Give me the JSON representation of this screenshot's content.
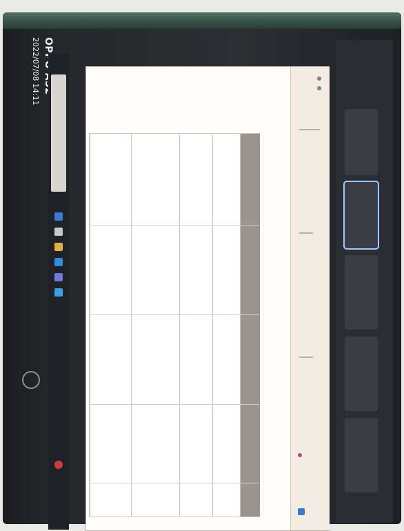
{
  "watermark": {
    "model": "OPPO A52",
    "datetime": "2022/07/08 14:11"
  },
  "colors": {
    "monitor": "#25272b",
    "page": "#fffdf9",
    "table_header": "#9b948d",
    "accent": "#9cc9ff"
  },
  "meeting": {
    "participants": [
      {
        "label": "",
        "active": false
      },
      {
        "label": "",
        "active": true
      },
      {
        "label": "",
        "active": false
      },
      {
        "label": "",
        "active": false
      },
      {
        "label": "",
        "active": false
      }
    ]
  }
}
